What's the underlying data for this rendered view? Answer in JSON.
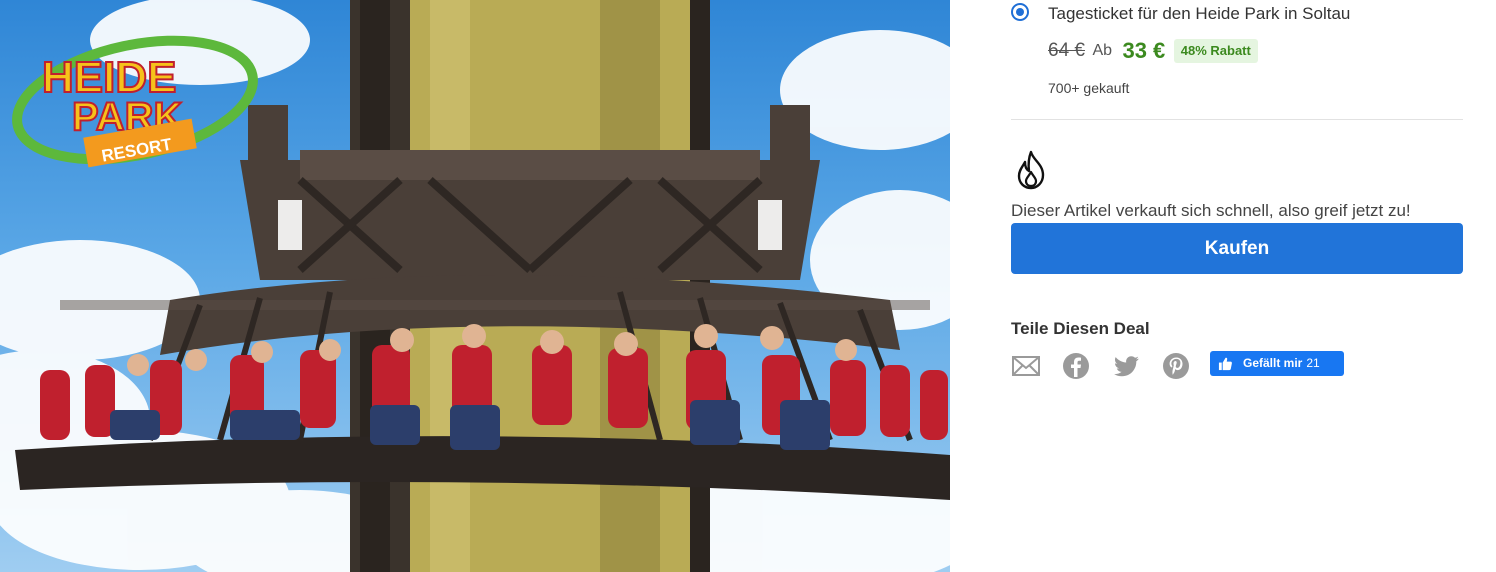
{
  "hero": {
    "logo_line1": "HEIDE",
    "logo_line2": "PARK",
    "logo_line3": "RESORT",
    "colors": {
      "sky": "#2f86d6",
      "tower": "#b9ab55",
      "seats": "#c0202e",
      "gondola": "#3d3530"
    }
  },
  "deal": {
    "option_title": "Tagesticket für den Heide Park in Soltau",
    "old_price": "64 €",
    "price_prefix": "Ab",
    "new_price": "33 €",
    "discount_badge": "48% Rabatt",
    "sold_count": "700+ gekauft",
    "urgency_icon": "fire-icon",
    "urgency_text": "Dieser Artikel verkauft sich schnell, also greif jetzt zu!",
    "buy_label": "Kaufen"
  },
  "share": {
    "title": "Teile Diesen Deal",
    "icons": [
      "email-icon",
      "facebook-icon",
      "twitter-icon",
      "pinterest-icon"
    ],
    "like_label": "Gefällt mir",
    "like_count": "21"
  },
  "colors": {
    "accent": "#2174d9",
    "price_green": "#3c8a1f",
    "badge_bg": "#e5f5e0",
    "like_blue": "#1877f2",
    "icon_gray": "#9a9a9a"
  }
}
